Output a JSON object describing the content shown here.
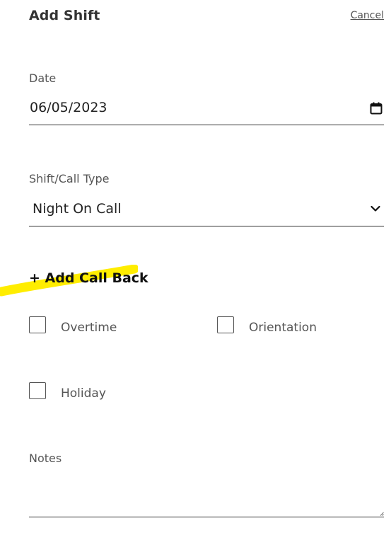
{
  "header": {
    "title": "Add Shift",
    "cancel_label": "Cancel"
  },
  "date": {
    "label": "Date",
    "value": "06/05/2023",
    "icon": "calendar-icon"
  },
  "shift_type": {
    "label": "Shift/Call Type",
    "selected": "Night On Call",
    "icon": "chevron-down-icon"
  },
  "call_back": {
    "label": "+ Add Call Back",
    "highlight_color": "#FFED00"
  },
  "options": {
    "overtime": {
      "label": "Overtime",
      "checked": false
    },
    "orientation": {
      "label": "Orientation",
      "checked": false
    },
    "holiday": {
      "label": "Holiday",
      "checked": false
    }
  },
  "notes": {
    "label": "Notes",
    "value": ""
  }
}
